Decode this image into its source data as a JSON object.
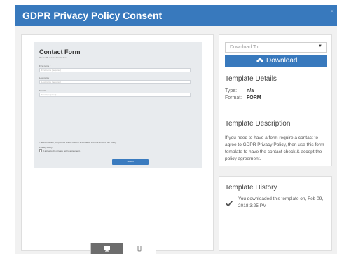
{
  "header": {
    "title": "GDPR Privacy Policy Consent"
  },
  "preview": {
    "form": {
      "title": "Contact Form",
      "subtitle": "Please fill out the form below",
      "fields": [
        {
          "label": "First name *",
          "placeholder": "First name (required)"
        },
        {
          "label": "Last name *",
          "placeholder": "Last name (required)"
        },
        {
          "label": "Email *",
          "placeholder": "Email (required)"
        }
      ],
      "note": "The information you provide will be used in accordance with the terms of our policy.",
      "privacy_label": "Privacy Policy *",
      "privacy_checkbox": "I agree to the privacy policy agreement.",
      "submit_label": "Submit"
    },
    "device_toggle": [
      "desktop-icon",
      "mobile-icon"
    ]
  },
  "sidebar": {
    "download_select": {
      "value": "Download To"
    },
    "download_button": {
      "label": "Download",
      "icon": "cloud-download-icon"
    },
    "details": {
      "title": "Template Details",
      "type_label": "Type:",
      "type_value": "n/a",
      "format_label": "Format:",
      "format_value": "FORM"
    },
    "description": {
      "title": "Template Description",
      "text": "If you need to have a form require a contact to agree to GDPR Privacy Policy, then use this form template to have the contact check & accept the policy agreement."
    },
    "history": {
      "title": "Template History",
      "entry": "You downloaded this template on, Feb 09, 2018 3:25 PM",
      "icon": "checkmark-icon"
    }
  },
  "colors": {
    "header": "#3879bd",
    "button": "#3879bd",
    "background": "#f1f1f1"
  }
}
